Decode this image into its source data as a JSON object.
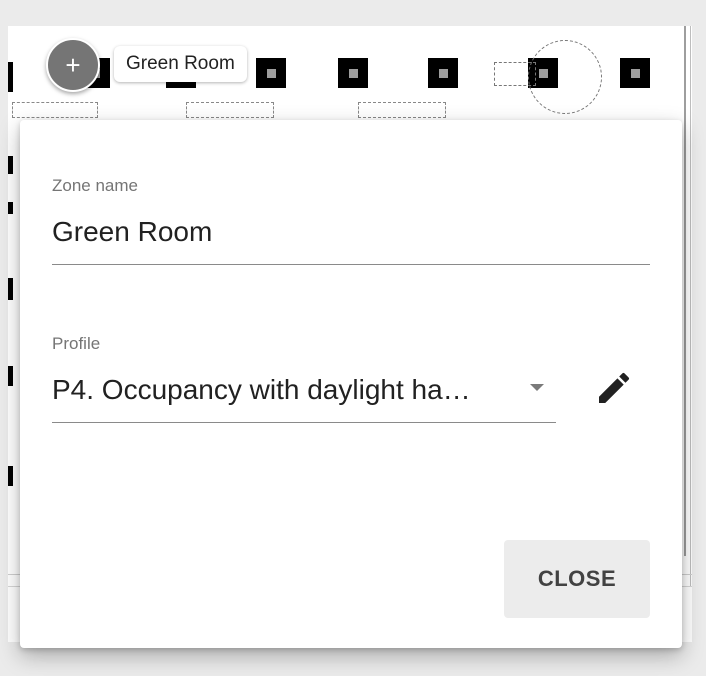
{
  "floorplan": {
    "zone_chip_label": "Green Room",
    "add_button_symbol": "+"
  },
  "dialog": {
    "zone_name": {
      "label": "Zone name",
      "value": "Green Room"
    },
    "profile": {
      "label": "Profile",
      "value": "P4. Occupancy with daylight ha…"
    },
    "close_label": "CLOSE"
  },
  "icons": {
    "add": "plus-icon",
    "dropdown": "arrow-drop-down-icon",
    "edit": "pencil-icon"
  },
  "colors": {
    "fab": "#757575",
    "close_button_bg": "#ececec",
    "label_text": "#757575"
  }
}
